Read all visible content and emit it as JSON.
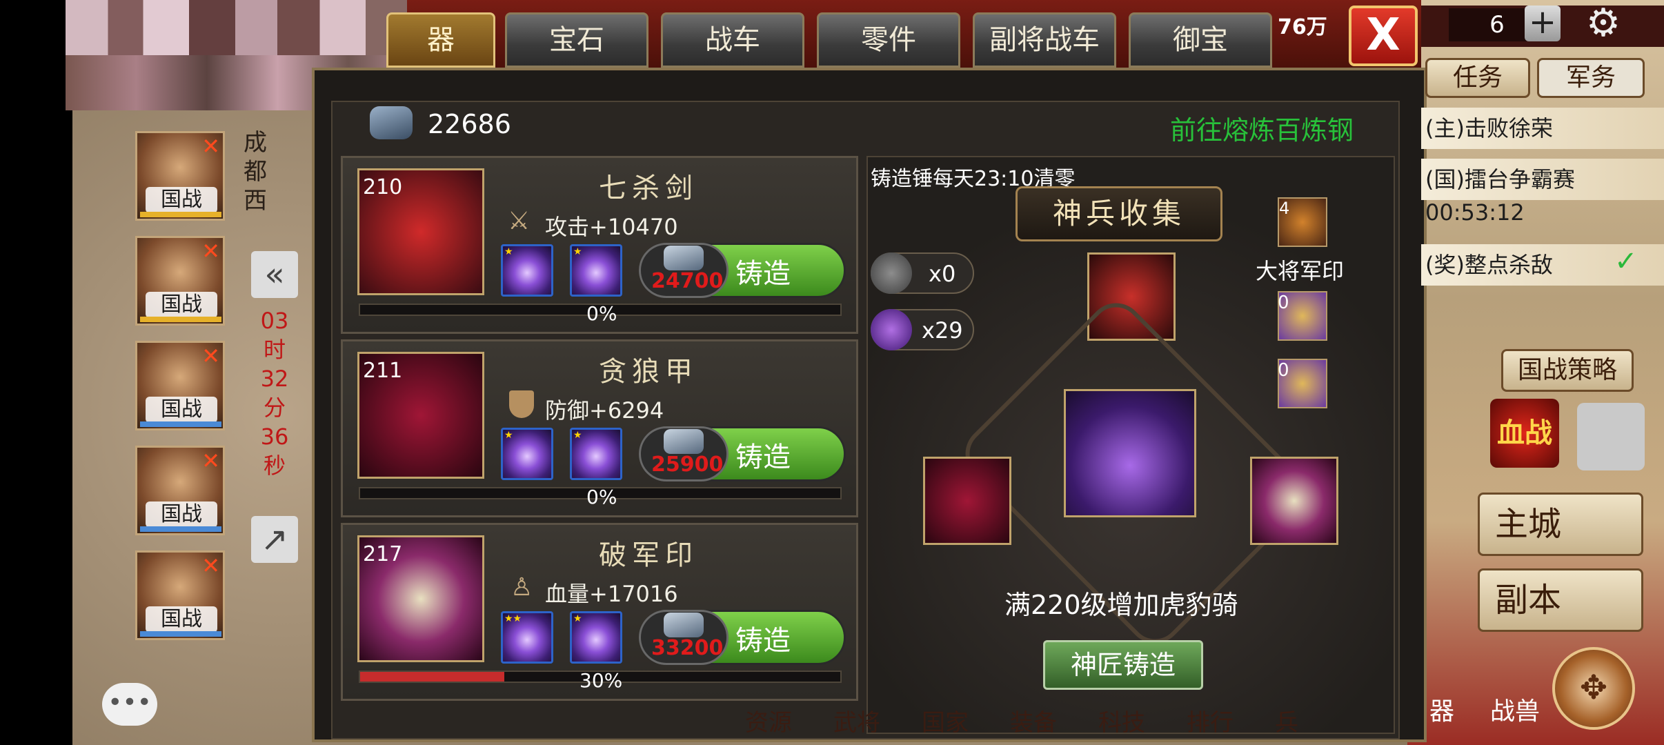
{
  "tabs": [
    {
      "label": "器"
    },
    {
      "label": "宝石"
    },
    {
      "label": "战车"
    },
    {
      "label": "零件"
    },
    {
      "label": "副将战车"
    },
    {
      "label": "御宝"
    }
  ],
  "top_right": {
    "currency_fragment": "76万",
    "count": "6"
  },
  "resource": {
    "steel_count": "22686",
    "goto_link": "前往熔炼百炼钢"
  },
  "items": [
    {
      "level": "210",
      "name": "七杀剑",
      "stat": "攻击+10470",
      "cost": "24700",
      "forge": "铸造",
      "progress_label": "0%",
      "progress": 0,
      "gem_stars": [
        1,
        1
      ]
    },
    {
      "level": "211",
      "name": "贪狼甲",
      "stat": "防御+6294",
      "cost": "25900",
      "forge": "铸造",
      "progress_label": "0%",
      "progress": 0,
      "gem_stars": [
        1,
        1
      ]
    },
    {
      "level": "217",
      "name": "破军印",
      "stat": "血量+17016",
      "cost": "33200",
      "forge": "铸造",
      "progress_label": "30%",
      "progress": 0.3,
      "gem_stars": [
        2,
        1
      ]
    }
  ],
  "collection": {
    "reset_note": "铸造锤每天23:10清零",
    "title": "神兵收集",
    "hammer1": "x0",
    "hammer2": "x29",
    "seal_count": "4",
    "seal_label": "大将军印",
    "hammer_gold_count1": "0",
    "hammer_gold_count2": "0",
    "bonus_text": "满220级增加虎豹骑",
    "master_forge": "神匠铸造"
  },
  "left_sidebar": {
    "city_name": [
      "成",
      "都",
      "西"
    ],
    "timer": [
      "03",
      "时",
      "32",
      "分",
      "36",
      "秒"
    ],
    "heroes": [
      {
        "tag": "国战"
      },
      {
        "tag": "国战"
      },
      {
        "tag": "国战"
      },
      {
        "tag": "国战"
      },
      {
        "tag": "国战"
      }
    ]
  },
  "right_sidebar": {
    "task_tab": "任务",
    "army_tab": "军务",
    "tasks": [
      "(主)击败徐荣",
      "(国)擂台争霸赛",
      "00:53:12",
      "(奖)整点杀敌"
    ],
    "national_strategy": "国战策略",
    "blood_war": "血战",
    "main_city": "主城",
    "dungeon": "副本",
    "beast": "战兽",
    "weapon_frag": "器"
  },
  "bottom_nav": [
    "资源",
    "武将",
    "国家",
    "装备",
    "科技",
    "排行",
    "兵"
  ]
}
